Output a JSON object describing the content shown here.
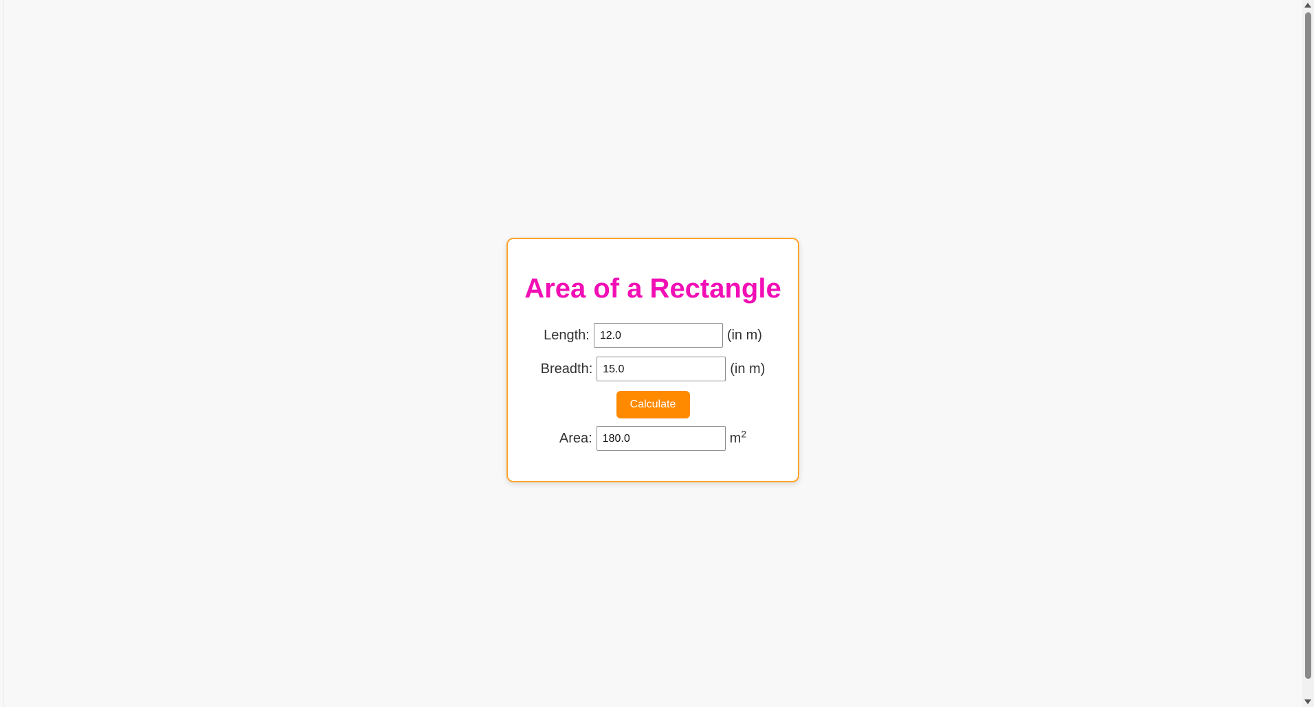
{
  "calculator": {
    "title": "Area of a Rectangle",
    "length": {
      "label": "Length:",
      "value": "12.0",
      "unit": "(in m)"
    },
    "breadth": {
      "label": "Breadth:",
      "value": "15.0",
      "unit": "(in m)"
    },
    "calculate_label": "Calculate",
    "area": {
      "label": "Area:",
      "value": "180.0",
      "unit_base": "m",
      "unit_exponent": "2"
    }
  },
  "colors": {
    "background": "#f8f8f8",
    "card_border": "#ffa52b",
    "title": "#f20fb5",
    "button": "#ff8a00",
    "button_text": "#ffffff"
  },
  "scrollbar": {
    "up_icon": "triangle-up",
    "down_icon": "triangle-down"
  }
}
